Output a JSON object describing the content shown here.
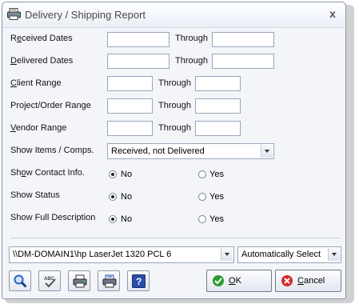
{
  "window": {
    "title": "Delivery / Shipping Report",
    "close_glyph": "x"
  },
  "fields": {
    "received_dates": {
      "label_u": "e",
      "label_pre": "R",
      "label_post": "ceived Dates",
      "through": "Through",
      "from": "",
      "to": ""
    },
    "delivered_dates": {
      "label_u": "D",
      "label_pre": "",
      "label_post": "elivered Dates",
      "through": "Through",
      "from": "",
      "to": ""
    },
    "client_range": {
      "label_u": "C",
      "label_pre": "",
      "label_post": "lient Range",
      "through": "Through",
      "from": "",
      "to": ""
    },
    "project_range": {
      "label_u": "",
      "label_pre": "Project/Order Range",
      "label_post": "",
      "through": "Through",
      "from": "",
      "to": ""
    },
    "vendor_range": {
      "label_u": "V",
      "label_pre": "",
      "label_post": "endor Range",
      "through": "Through",
      "from": "",
      "to": ""
    }
  },
  "show_items": {
    "label": "Show Items / Comps.",
    "value": "Received, not Delivered"
  },
  "show_contact": {
    "label_pre": "Sh",
    "label_u": "o",
    "label_post": "w Contact Info.",
    "no": "No",
    "yes": "Yes",
    "selected": "No"
  },
  "show_status": {
    "label": "Show Status",
    "no": "No",
    "yes": "Yes",
    "selected": "No"
  },
  "show_full_description": {
    "label": "Show Full Description",
    "no": "No",
    "yes": "Yes",
    "selected": "No"
  },
  "printer": {
    "value": "\\\\DM-DOMAIN1\\hp LaserJet 1320 PCL 6"
  },
  "tray": {
    "value": "Automatically Select"
  },
  "buttons": {
    "ok": "OK",
    "ok_u": "O",
    "ok_rest": "K",
    "cancel": "Cancel",
    "cancel_u": "C",
    "cancel_rest": "ancel"
  },
  "icons": {
    "title": "report-icon",
    "preview": "magnifier-icon",
    "spell": "spell-check-icon",
    "print": "printer-icon",
    "print_setup": "print-setup-icon",
    "help": "help-icon",
    "ok": "check-icon",
    "cancel": "cancel-icon"
  },
  "colors": {
    "ok_icon": "#2e9a2e",
    "cancel_icon": "#d42a2a",
    "help_icon": "#2a4fa8",
    "magnifier": "#2a62c9"
  }
}
